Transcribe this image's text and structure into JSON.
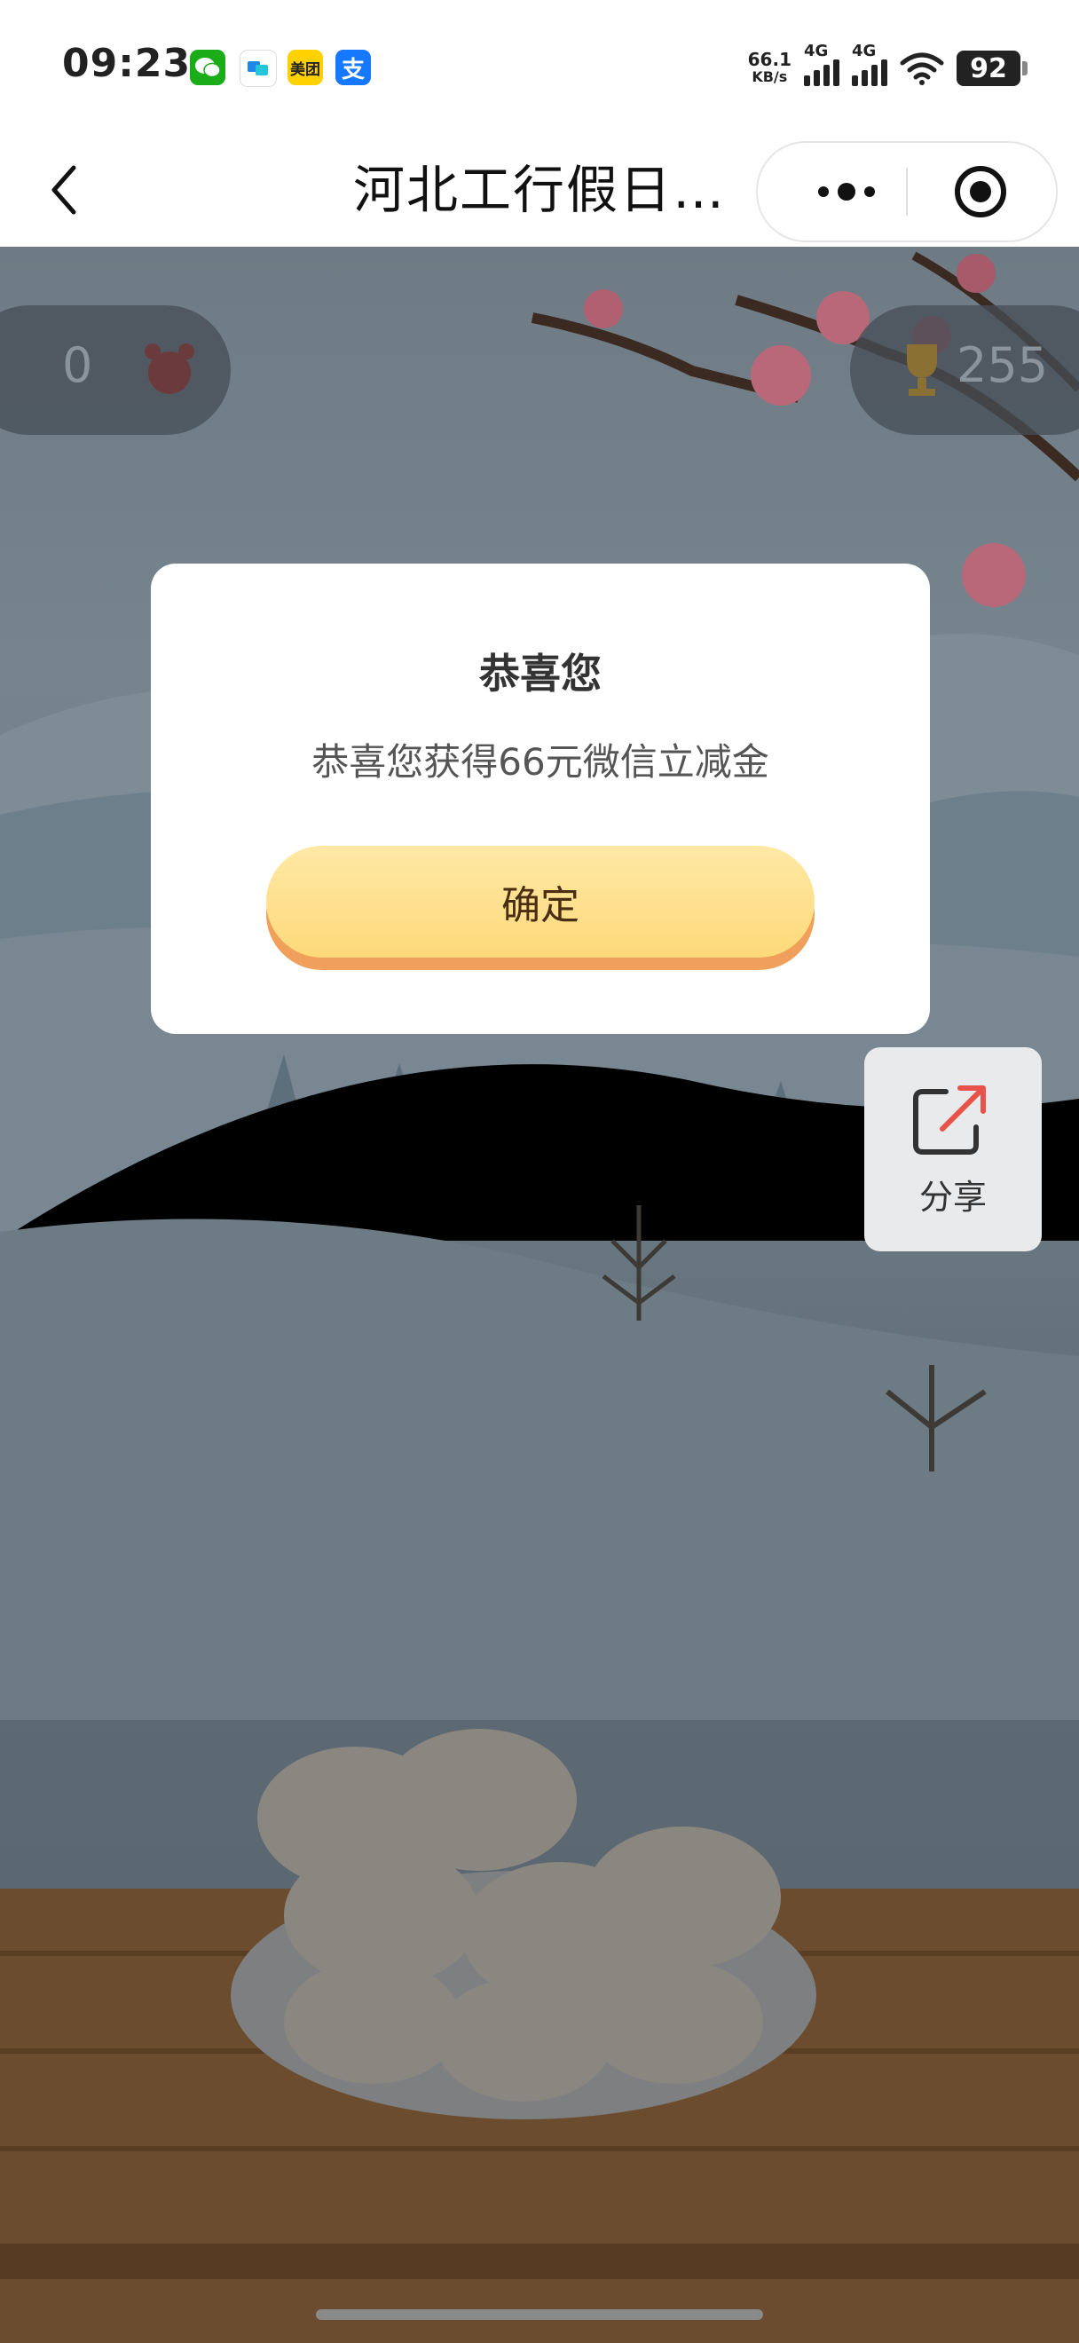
{
  "status_bar": {
    "time": "09:23",
    "apps": [
      {
        "icon": "wechat-icon",
        "color": "#1AAD19",
        "text": ""
      },
      {
        "icon": "chat-bubble-icon",
        "color": "#ffffff",
        "text": ""
      },
      {
        "icon": "meituan-icon",
        "color": "#FFD100",
        "text": "美团"
      },
      {
        "icon": "alipay-icon",
        "color": "#1677FF",
        "text": "支"
      }
    ],
    "speed_value": "66.1",
    "speed_unit": "KB/s",
    "net1": "4G",
    "net2": "4G",
    "battery": "92"
  },
  "nav": {
    "title": "河北工行假日…"
  },
  "hud": {
    "left_count": "0",
    "right_score": "255"
  },
  "modal": {
    "title": "恭喜您",
    "message": "恭喜您获得66元微信立减金",
    "confirm_label": "确定"
  },
  "share": {
    "label": "分享"
  },
  "colors": {
    "overlay": "#5f6c76",
    "button_top": "#ffe9a6",
    "button_bottom": "#fdd97a",
    "button_shadow": "#f0a05a",
    "share_arrow": "#e8524a"
  }
}
